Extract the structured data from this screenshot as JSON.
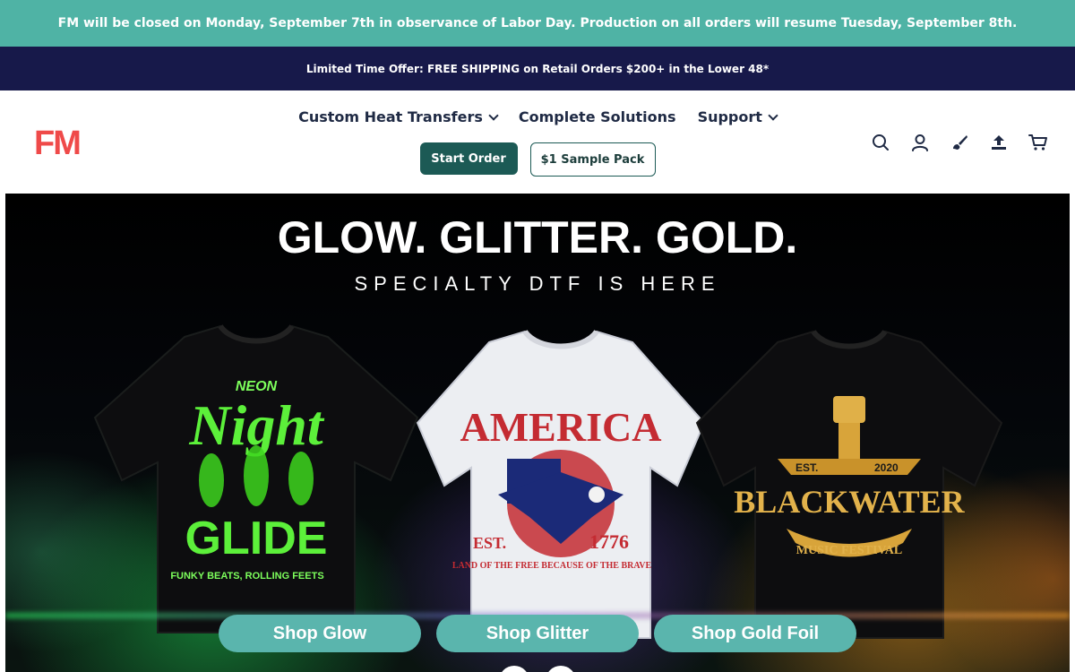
{
  "announcement": {
    "text": "FM will be closed on Monday, September 7th in observance of Labor Day. Production on all orders will resume Tuesday, September 8th."
  },
  "promo": {
    "text": "Limited Time Offer: FREE SHIPPING on Retail Orders $200+ in the Lower 48*"
  },
  "header": {
    "logo_text": "FM",
    "nav": [
      {
        "label": "Custom Heat Transfers",
        "has_dropdown": true
      },
      {
        "label": "Complete Solutions",
        "has_dropdown": false
      },
      {
        "label": "Support",
        "has_dropdown": true
      }
    ],
    "start_order_label": "Start Order",
    "sample_pack_label": "$1 Sample Pack",
    "icons": [
      "search-icon",
      "account-icon",
      "brush-icon",
      "upload-icon",
      "cart-icon"
    ]
  },
  "hero": {
    "title": "GLOW. GLITTER. GOLD.",
    "subtitle": "SPECIALTY DTF IS HERE",
    "shirts": {
      "green": {
        "line1": "NEON",
        "line2": "Night",
        "line3": "GLIDE",
        "line4": "FUNKY BEATS, ROLLING FEETS"
      },
      "white": {
        "line1": "AMERICA",
        "est": "EST.",
        "year": "1776",
        "tagline": "LAND OF THE FREE BECAUSE OF THE BRAVE"
      },
      "gold": {
        "est": "EST.",
        "year": "2020",
        "name": "BLACKWATER",
        "sub": "MUSIC FESTIVAL"
      }
    },
    "buttons": [
      "Shop Glow",
      "Shop Glitter",
      "Shop Gold Foil"
    ]
  },
  "colors": {
    "announcement_bg": "#4fb3a5",
    "promo_bg": "#17194a",
    "logo": "#ef4a49",
    "primary_button": "#1c5a55",
    "shop_button": "#5ab5ad",
    "nav_text": "#1f2a44"
  }
}
